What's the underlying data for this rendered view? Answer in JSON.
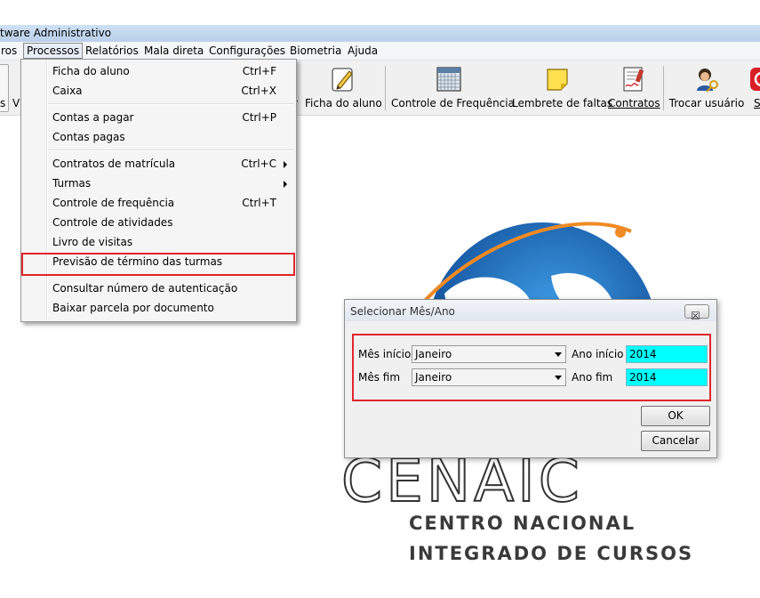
{
  "window": {
    "title": "tware Administrativo"
  },
  "menubar": {
    "items": [
      {
        "label": "ros"
      },
      {
        "label": "Processos"
      },
      {
        "label": "Relatórios"
      },
      {
        "label": "Mala direta"
      },
      {
        "label": "Configurações"
      },
      {
        "label": "Biometria"
      },
      {
        "label": "Ajuda"
      }
    ]
  },
  "toolbar": {
    "left_partial_1": "s",
    "left_partial_2": "V",
    "partial_r": "r",
    "buttons": [
      {
        "label": "Ficha do aluno",
        "icon": "pencil-note-icon"
      },
      {
        "label": "Controle de Frequência",
        "icon": "calendar-grid-icon"
      },
      {
        "label": "Lembrete de faltas",
        "icon": "sticky-note-icon"
      },
      {
        "label": "Contratos",
        "icon": "signed-document-icon"
      },
      {
        "label": "Trocar usuário",
        "icon": "user-key-icon"
      },
      {
        "label": "S",
        "icon": "exit-icon"
      }
    ]
  },
  "processos_menu": {
    "items": [
      {
        "label": "Ficha do aluno",
        "shortcut": "Ctrl+F"
      },
      {
        "label": "Caixa",
        "shortcut": "Ctrl+X"
      },
      {
        "label": "Contas a pagar",
        "shortcut": "Ctrl+P"
      },
      {
        "label": "Contas pagas",
        "shortcut": ""
      },
      {
        "label": "Contratos de matrícula",
        "shortcut": "Ctrl+C"
      },
      {
        "label": "Turmas",
        "shortcut": ""
      },
      {
        "label": "Controle de frequência",
        "shortcut": "Ctrl+T"
      },
      {
        "label": "Controle de atividades",
        "shortcut": ""
      },
      {
        "label": "Livro de visitas",
        "shortcut": ""
      },
      {
        "label": "Previsão de término das turmas",
        "shortcut": ""
      },
      {
        "label": "Consultar número de autenticação",
        "shortcut": ""
      },
      {
        "label": "Baixar parcela por documento",
        "shortcut": ""
      }
    ]
  },
  "dialog": {
    "title": "Selecionar Mês/Ano",
    "close_glyph": "☒",
    "mes_inicio_label": "Mês início",
    "mes_inicio_value": "Janeiro",
    "ano_inicio_label": "Ano início",
    "ano_inicio_value": "2014",
    "mes_fim_label": "Mês fim",
    "mes_fim_value": "Janeiro",
    "ano_fim_label": "Ano fim",
    "ano_fim_value": "2014",
    "ok_label": "OK",
    "cancel_label": "Cancelar"
  },
  "logo": {
    "name": "CENAIC",
    "line1": "CENTRO NACIONAL",
    "line2": "INTEGRADO DE CURSOS"
  },
  "colors": {
    "highlight_box": "#e0262d",
    "input_highlight": "#00ffff"
  }
}
